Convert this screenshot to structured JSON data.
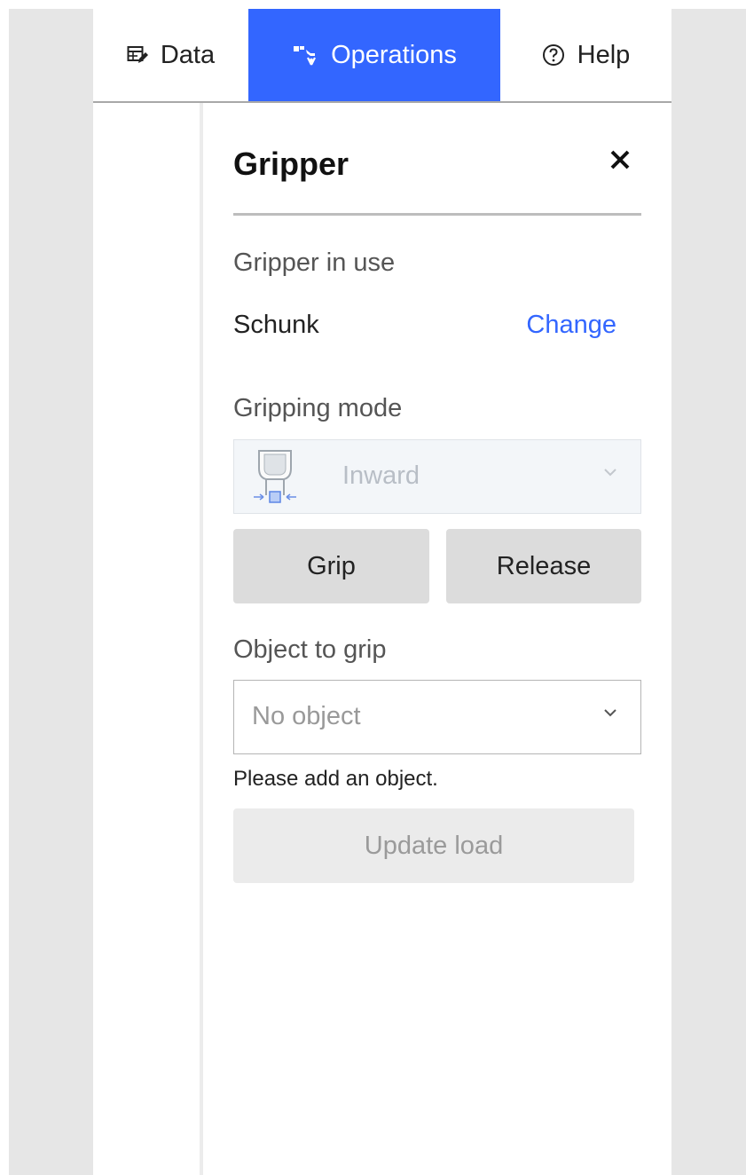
{
  "tabs": {
    "data": {
      "label": "Data",
      "icon": "table-edit-icon"
    },
    "operations": {
      "label": "Operations",
      "icon": "gripper-icon",
      "active": true
    },
    "help": {
      "label": "Help",
      "icon": "question-circle-icon"
    }
  },
  "panel": {
    "title": "Gripper",
    "close_icon": "close-icon",
    "gripper_in_use": {
      "label": "Gripper in use",
      "value": "Schunk",
      "change_link": "Change"
    },
    "gripping_mode": {
      "label": "Gripping mode",
      "selected": "Inward",
      "icon": "inward-grip-icon",
      "disabled": true
    },
    "actions": {
      "grip_label": "Grip",
      "release_label": "Release"
    },
    "object_to_grip": {
      "label": "Object to grip",
      "placeholder": "No object",
      "hint": "Please add an object."
    },
    "update_load_label": "Update load"
  },
  "colors": {
    "accent": "#3366ff",
    "frame": "#e6e6e6",
    "button": "#dcdcdc",
    "button_disabled": "#ebebeb"
  }
}
